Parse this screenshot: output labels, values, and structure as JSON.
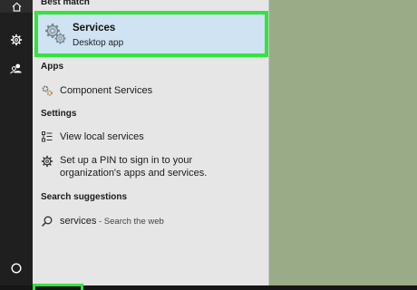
{
  "rail": {
    "items": [
      {
        "name": "home-icon"
      },
      {
        "name": "gear-icon"
      },
      {
        "name": "people-icon"
      },
      {
        "name": "cortana-icon"
      }
    ]
  },
  "best_match": {
    "heading": "Best match",
    "title": "Services",
    "subtitle": "Desktop app",
    "highlight_color": "#36e33c"
  },
  "apps": {
    "heading": "Apps",
    "items": [
      {
        "label": "Component Services"
      }
    ]
  },
  "settings": {
    "heading": "Settings",
    "items": [
      {
        "label": "View local services"
      },
      {
        "line1": "Set up a PIN to sign in to your",
        "line2": "organization's apps and services."
      }
    ]
  },
  "suggestions": {
    "heading": "Search suggestions",
    "items": [
      {
        "query": "services",
        "suffix": " - Search the web"
      }
    ]
  },
  "colors": {
    "desktop": "#9aab88",
    "panel": "#e6e6e6",
    "selected": "#cfe3f3",
    "rail": "#1f1f1f",
    "accent": "#1a73c8"
  }
}
